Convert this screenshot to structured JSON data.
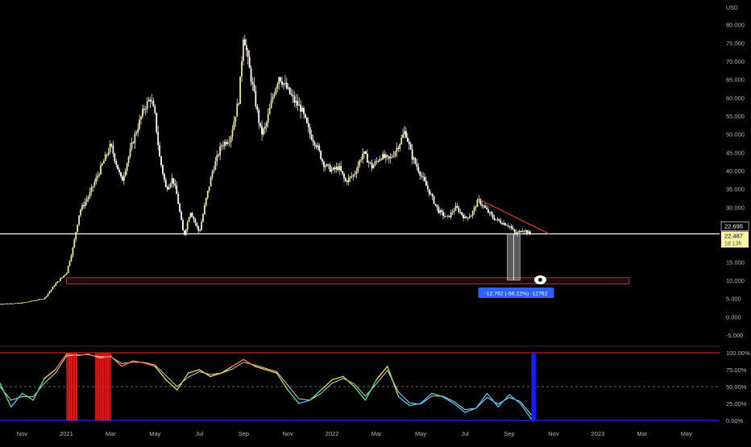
{
  "colors": {
    "background": "#000000",
    "candle": "#f0e68c",
    "wick": "#ffffff",
    "trendline": "#e03030",
    "support_line": "#ffffff",
    "box_stroke": "#b03040",
    "measure_badge": "#2962ff",
    "price_badge": "#fff3a8",
    "rsi_top_line": "#e03030",
    "rsi_bottom_line": "#2020ff",
    "red_highlight": "#ff1a1a",
    "blue_highlight": "#1a1aff"
  },
  "price_axis": {
    "currency": "USD",
    "ticks": [
      {
        "value": 80000,
        "label": "80.000"
      },
      {
        "value": 75000,
        "label": "75.000"
      },
      {
        "value": 70000,
        "label": "70.000"
      },
      {
        "value": 65000,
        "label": "65.000"
      },
      {
        "value": 60000,
        "label": "60.000"
      },
      {
        "value": 55000,
        "label": "55.000"
      },
      {
        "value": 50000,
        "label": "50.000"
      },
      {
        "value": 45000,
        "label": "45.000"
      },
      {
        "value": 40000,
        "label": "40.000"
      },
      {
        "value": 35000,
        "label": "35.000"
      },
      {
        "value": 30000,
        "label": "30.000"
      },
      {
        "value": 15000,
        "label": "15.000"
      },
      {
        "value": 10000,
        "label": "10.000"
      },
      {
        "value": 5000,
        "label": "5.000"
      },
      {
        "value": 0,
        "label": "0.000"
      },
      {
        "value": -5000,
        "label": "-5.000"
      }
    ],
    "ylim": [
      -7000,
      85000
    ],
    "current_price_label": "22.487",
    "countdown_label": "1d 13h",
    "level_label": "22.695"
  },
  "time_axis": {
    "ticks": [
      {
        "t": 1.0,
        "label": "Nov"
      },
      {
        "t": 3.0,
        "label": "2021"
      },
      {
        "t": 5.0,
        "label": "Mar"
      },
      {
        "t": 7.0,
        "label": "May"
      },
      {
        "t": 9.0,
        "label": "Jul"
      },
      {
        "t": 11.0,
        "label": "Sep"
      },
      {
        "t": 13.0,
        "label": "Nov"
      },
      {
        "t": 15.0,
        "label": "2022"
      },
      {
        "t": 17.0,
        "label": "Mar"
      },
      {
        "t": 19.0,
        "label": "May"
      },
      {
        "t": 21.0,
        "label": "Jul"
      },
      {
        "t": 23.0,
        "label": "Sep"
      },
      {
        "t": 25.0,
        "label": "Nov"
      },
      {
        "t": 27.0,
        "label": "2023"
      },
      {
        "t": 29.0,
        "label": "Mar"
      },
      {
        "t": 31.0,
        "label": "May"
      }
    ],
    "xlim": [
      0.0,
      32.5
    ]
  },
  "chart_data": {
    "type": "line",
    "title": "",
    "xlabel": "",
    "ylabel": "",
    "price_series": {
      "t": [
        0.0,
        1.0,
        2.0,
        2.5,
        3.0,
        3.3,
        3.6,
        4.0,
        4.5,
        5.0,
        5.5,
        6.0,
        6.5,
        6.8,
        7.0,
        7.2,
        7.5,
        7.8,
        8.0,
        8.3,
        8.6,
        9.0,
        9.3,
        9.6,
        10.0,
        10.4,
        10.8,
        11.0,
        11.2,
        11.5,
        11.8,
        12.0,
        12.3,
        12.6,
        13.0,
        13.3,
        13.6,
        14.0,
        14.3,
        14.6,
        15.0,
        15.3,
        15.6,
        16.0,
        16.4,
        16.8,
        17.2,
        17.6,
        18.0,
        18.3,
        18.6,
        19.0,
        19.4,
        19.8,
        20.2,
        20.6,
        21.0,
        21.3,
        21.6,
        22.0,
        22.3,
        22.6,
        23.0,
        23.3,
        23.6,
        24.0
      ],
      "close": [
        3500,
        3800,
        5000,
        9000,
        12000,
        19000,
        29000,
        33000,
        40000,
        47000,
        37000,
        48000,
        57000,
        60000,
        55000,
        44000,
        35000,
        38000,
        33000,
        22000,
        29000,
        23000,
        32000,
        40000,
        47000,
        49000,
        60000,
        78000,
        70000,
        60000,
        50000,
        52000,
        60000,
        66000,
        62000,
        59000,
        57000,
        50000,
        47000,
        42000,
        40000,
        41000,
        37000,
        39000,
        45000,
        41000,
        44000,
        43000,
        47000,
        51000,
        44000,
        39000,
        34000,
        29000,
        27000,
        30000,
        27000,
        28000,
        32000,
        29000,
        27000,
        26000,
        25000,
        22500,
        24000,
        22487
      ]
    },
    "trendline": {
      "t": [
        21.7,
        24.8
      ],
      "y": [
        32000,
        22695
      ]
    },
    "support_level": {
      "y": 22695,
      "label": "22.695"
    },
    "zone": {
      "t": [
        3.0,
        28.4
      ],
      "y": [
        9000,
        10700
      ]
    },
    "measure": {
      "t": 23.2,
      "from": 22762,
      "to": 10000,
      "label": "-12.762 (-56.22%) -12762"
    },
    "oscillator": {
      "ylim": [
        0,
        100
      ],
      "ticks": [
        {
          "value": 100,
          "label": "100.00%"
        },
        {
          "value": 75,
          "label": "75.00%"
        },
        {
          "value": 50,
          "label": "50.00%"
        },
        {
          "value": 25,
          "label": "25.00%"
        },
        {
          "value": 0,
          "label": "0.00%"
        }
      ],
      "t": [
        0.0,
        0.5,
        1.0,
        1.5,
        2.0,
        2.5,
        3.0,
        3.5,
        4.0,
        4.5,
        5.0,
        5.5,
        6.0,
        6.5,
        7.0,
        7.5,
        8.0,
        8.5,
        9.0,
        9.5,
        10.0,
        10.5,
        11.0,
        11.5,
        12.0,
        12.5,
        13.0,
        13.5,
        14.0,
        14.5,
        15.0,
        15.5,
        16.0,
        16.5,
        17.0,
        17.5,
        18.0,
        18.5,
        19.0,
        19.5,
        20.0,
        20.5,
        21.0,
        21.5,
        22.0,
        22.5,
        23.0,
        23.5,
        24.0
      ],
      "k": [
        55,
        20,
        40,
        30,
        62,
        75,
        98,
        96,
        98,
        92,
        95,
        80,
        88,
        85,
        80,
        60,
        45,
        70,
        75,
        65,
        70,
        80,
        90,
        80,
        75,
        70,
        45,
        25,
        30,
        45,
        60,
        65,
        50,
        30,
        60,
        80,
        35,
        22,
        25,
        40,
        35,
        25,
        12,
        18,
        40,
        20,
        38,
        25,
        2
      ],
      "d": [
        50,
        30,
        35,
        35,
        55,
        70,
        95,
        97,
        97,
        94,
        94,
        84,
        86,
        86,
        82,
        66,
        50,
        64,
        72,
        68,
        70,
        76,
        86,
        82,
        77,
        72,
        52,
        32,
        30,
        40,
        55,
        62,
        54,
        36,
        54,
        74,
        42,
        26,
        24,
        36,
        36,
        28,
        16,
        18,
        34,
        24,
        34,
        28,
        8
      ],
      "red_highlights": [
        {
          "t0": 3.0,
          "t1": 3.5
        },
        {
          "t0": 4.3,
          "t1": 5.0
        }
      ],
      "blue_highlight": {
        "t0": 24.0,
        "t1": 24.2
      }
    }
  }
}
